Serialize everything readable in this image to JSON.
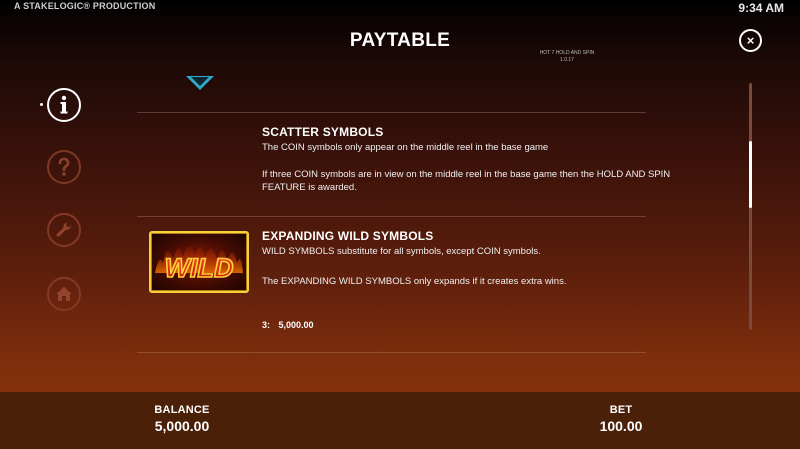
{
  "header": {
    "brand": "A STAKELOGIC® PRODUCTION",
    "time": "9:34 AM",
    "title": "PAYTABLE",
    "version_line1": "HOT 7 HOLD AND SPIN",
    "version_line2": "1.0.17",
    "close_symbol": "×"
  },
  "sidebar": {
    "items": [
      {
        "icon": "info-icon",
        "active": true
      },
      {
        "icon": "help-icon",
        "active": false
      },
      {
        "icon": "wrench-icon",
        "active": false
      },
      {
        "icon": "home-icon",
        "active": false
      }
    ]
  },
  "sections": {
    "scatter": {
      "title": "SCATTER SYMBOLS",
      "line1": "The COIN symbols only appear on the middle reel in the base game",
      "line2": "If three COIN symbols are in view on the middle reel in the base game then the HOLD AND SPIN FEATURE is awarded."
    },
    "wild": {
      "title": "EXPANDING WILD SYMBOLS",
      "line1": "WILD SYMBOLS substitute for all symbols, except COIN symbols.",
      "line2": "The EXPANDING WILD SYMBOLS only expands if it creates extra wins.",
      "symbol_text": "WILD",
      "pay_count": "3:",
      "pay_value": "5,000.00"
    }
  },
  "footer": {
    "balance_label": "BALANCE",
    "balance_value": "5,000.00",
    "bet_label": "BET",
    "bet_value": "100.00"
  },
  "colors": {
    "accent_arrow": "#2fa8c9",
    "wild_border": "#f5d13a",
    "bottom_bar": "#4a2009"
  }
}
